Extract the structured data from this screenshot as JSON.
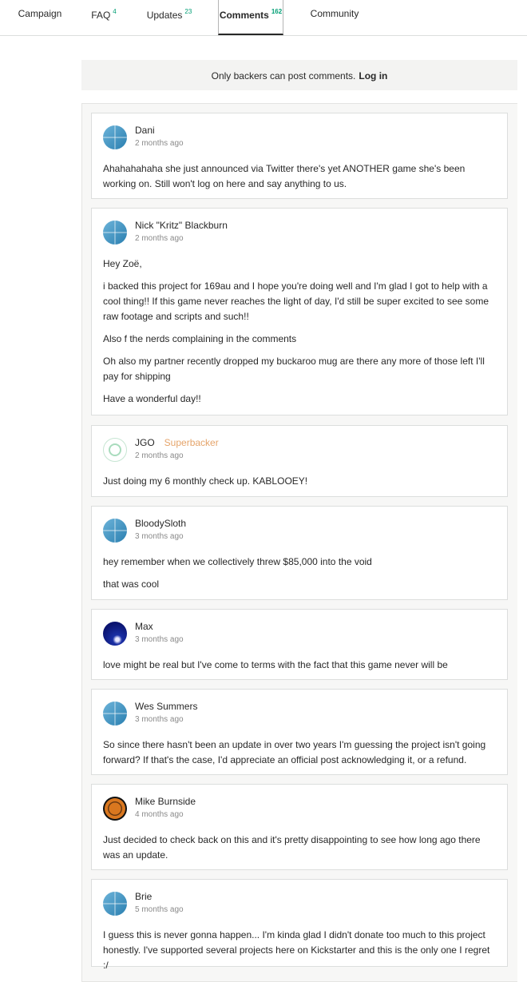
{
  "tabs": [
    {
      "label": "Campaign",
      "count": ""
    },
    {
      "label": "FAQ",
      "count": "4"
    },
    {
      "label": "Updates",
      "count": "23"
    },
    {
      "label": "Comments",
      "count": "162"
    },
    {
      "label": "Community",
      "count": ""
    }
  ],
  "notice": {
    "text": "Only backers can post comments.",
    "login": "Log in"
  },
  "comments": [
    {
      "author": "Dani",
      "badge": "",
      "time": "2 months ago",
      "paragraphs": [
        "Ahahahahaha she just announced via Twitter there's yet ANOTHER game she's been working on. Still won't log on here and say anything to us."
      ]
    },
    {
      "author": "Nick \"Kritz\" Blackburn",
      "badge": "",
      "time": "2 months ago",
      "paragraphs": [
        "Hey Zoë,",
        "i backed this project for 169au and I hope you're doing well and I'm glad I got to help with a cool thing!! If this game never reaches the light of day, I'd still be super excited to see some raw footage and scripts and such!!",
        "Also f the nerds complaining in the comments",
        "Oh also my partner recently dropped my buckaroo mug are there any more of those left I'll pay for shipping",
        "Have a wonderful day!!"
      ]
    },
    {
      "author": "JGO",
      "badge": "Superbacker",
      "time": "2 months ago",
      "paragraphs": [
        "Just doing my 6 monthly check up. KABLOOEY!"
      ]
    },
    {
      "author": "BloodySloth",
      "badge": "",
      "time": "3 months ago",
      "paragraphs": [
        "hey remember when we collectively threw $85,000 into the void",
        "that was cool"
      ]
    },
    {
      "author": "Max",
      "badge": "",
      "time": "3 months ago",
      "paragraphs": [
        "love might be real but I've come to terms with the fact that this game never will be"
      ]
    },
    {
      "author": "Wes Summers",
      "badge": "",
      "time": "3 months ago",
      "paragraphs": [
        "So since there hasn't been an update in over two years I'm guessing the project isn't going forward? If that's the case, I'd appreciate an official post acknowledging it, or a refund."
      ]
    },
    {
      "author": "Mike Burnside",
      "badge": "",
      "time": "4 months ago",
      "paragraphs": [
        "Just decided to check back on this and it's pretty disappointing to see how long ago there was an update."
      ]
    },
    {
      "author": "Brie",
      "badge": "",
      "time": "5 months ago",
      "paragraphs": [
        "I guess this is never gonna happen... I'm kinda glad I didn't donate too much to this project honestly. I've supported several projects here on Kickstarter and this is the only one I regret :/"
      ]
    }
  ]
}
